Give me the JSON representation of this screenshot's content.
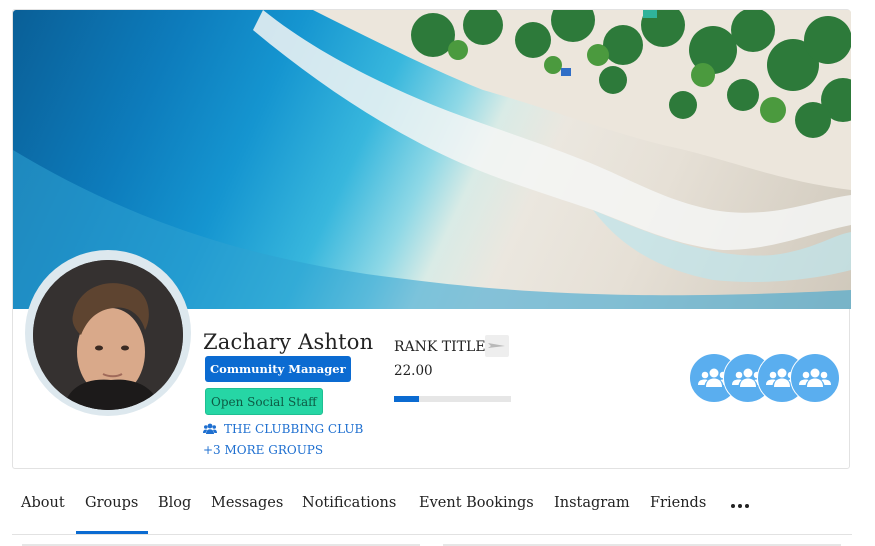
{
  "profile": {
    "name": "Zachary Ashton",
    "role_badge": "Community Manager",
    "staff_badge": "Open Social Staff",
    "group_name": "THE CLUBBING CLUB",
    "more_groups": "+3 MORE GROUPS"
  },
  "rank": {
    "title": "RANK TITLE",
    "points": "22.00",
    "progress_fraction": 0.21
  },
  "groups_icons": [
    "group-icon",
    "group-icon",
    "group-icon",
    "group-icon"
  ],
  "tabs": [
    {
      "label": "About"
    },
    {
      "label": "Groups"
    },
    {
      "label": "Blog"
    },
    {
      "label": "Messages"
    },
    {
      "label": "Notifications"
    },
    {
      "label": "Event Bookings"
    },
    {
      "label": "Instagram"
    },
    {
      "label": "Friends"
    }
  ],
  "active_tab": "Groups",
  "colors": {
    "accent": "#0b6bd1",
    "staff_badge": "#26d6a5",
    "group_circle": "#5aaeef",
    "link": "#1e6fd0"
  }
}
